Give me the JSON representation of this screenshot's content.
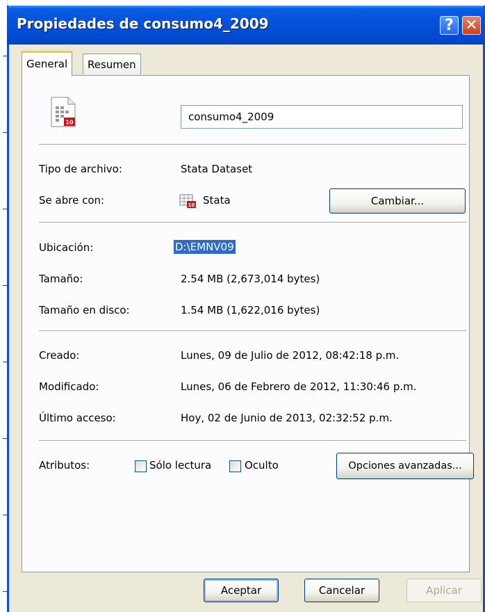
{
  "window": {
    "title": "Propiedades de consumo4_2009",
    "help_glyph": "?",
    "close_glyph": "✕"
  },
  "tabs": [
    {
      "label": "General",
      "active": true
    },
    {
      "label": "Resumen",
      "active": false
    }
  ],
  "file": {
    "name_value": "consumo4_2009",
    "icon": "stata-dataset-file-icon"
  },
  "info": {
    "type_label": "Tipo de archivo:",
    "type_value": "Stata Dataset",
    "opens_with_label": "Se abre con:",
    "opens_with_value": "Stata",
    "opens_with_icon": "stata-app-icon",
    "change_button": "Cambiar...",
    "location_label": "Ubicación:",
    "location_value": "D:\\EMNV09",
    "size_label": "Tamaño:",
    "size_value": "2.54 MB (2,673,014 bytes)",
    "disk_size_label": "Tamaño en disco:",
    "disk_size_value": "1.54 MB (1,622,016 bytes)",
    "created_label": "Creado:",
    "created_value": "Lunes, 09 de Julio de 2012, 08:42:18 p.m.",
    "modified_label": "Modificado:",
    "modified_value": "Lunes, 06 de Febrero de 2012, 11:30:46 p.m.",
    "accessed_label": "Último acceso:",
    "accessed_value": "Hoy, 02 de Junio de 2013, 02:32:52 p.m."
  },
  "attributes": {
    "label": "Atributos:",
    "readonly_label": "Sólo lectura",
    "readonly_checked": false,
    "hidden_label": "Oculto",
    "hidden_checked": false,
    "advanced_button": "Opciones avanzadas..."
  },
  "footer": {
    "ok_button": "Aceptar",
    "cancel_button": "Cancelar",
    "apply_button": "Aplicar"
  },
  "colors": {
    "titlebar": "#0552DA",
    "dialog_bg": "#ECE9D8",
    "selection": "#316AC5",
    "tab_highlight": "#FFC83C"
  }
}
